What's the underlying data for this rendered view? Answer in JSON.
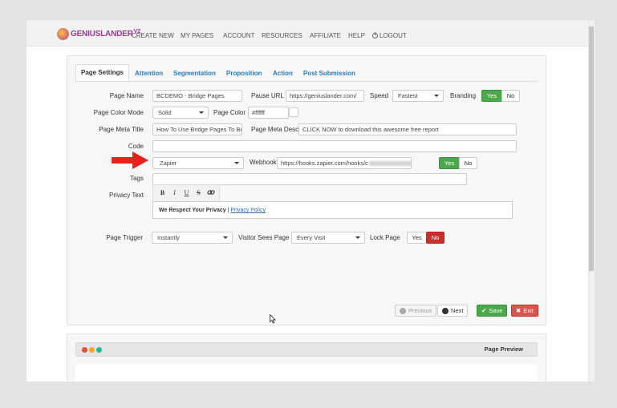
{
  "app": {
    "logo_text": "GENIUSLANDER",
    "logo_version": "V2"
  },
  "nav": {
    "items": [
      "CREATE NEW",
      "MY PAGES",
      "ACCOUNT",
      "RESOURCES",
      "AFFILIATE",
      "HELP"
    ],
    "logout_label": "LOGOUT"
  },
  "tabs": [
    "Page Settings",
    "Attention",
    "Segmentation",
    "Proposition",
    "Action",
    "Post Submission"
  ],
  "active_tab": "Page Settings",
  "form": {
    "page_name": {
      "label": "Page Name",
      "value": "BCDEMO - Bridge Pages"
    },
    "pause_url": {
      "label": "Pause URL",
      "value": "https://geniuslander.com/"
    },
    "speed": {
      "label": "Speed",
      "value": "Fastest"
    },
    "branding": {
      "label": "Branding",
      "yes": "Yes",
      "no": "No",
      "selected": "Yes"
    },
    "page_color_mode": {
      "label": "Page Color Mode",
      "value": "Solid"
    },
    "page_color": {
      "label": "Page Color",
      "value": "#ffffff"
    },
    "page_meta_title": {
      "label": "Page Meta Title",
      "value": "How To Use Bridge Pages To Bc"
    },
    "page_meta_desc": {
      "label": "Page Meta Desc",
      "value": "CLICK NOW to download this awesome free report"
    },
    "code": {
      "label": "Code",
      "value": ""
    },
    "integration": {
      "value": "Zapier"
    },
    "webhook": {
      "label": "Webhook",
      "value": "https://hooks.zapier.com/hooks/c",
      "yes": "Yes",
      "no": "No",
      "selected": "Yes"
    },
    "tags": {
      "label": "Tags",
      "value": ""
    },
    "privacy_text": {
      "label": "Privacy Text",
      "toolbar": [
        "B",
        "I",
        "U",
        "S",
        "link"
      ],
      "content_bold": "We Respect Your Privacy",
      "content_sep": " | ",
      "content_link": "Privacy Policy"
    },
    "page_trigger": {
      "label": "Page Trigger",
      "value": "Instantly"
    },
    "visitor_sees_page": {
      "label": "Visitor Sees Page",
      "value": "Every Visit"
    },
    "lock_page": {
      "label": "Lock Page",
      "yes": "Yes",
      "no": "No",
      "selected": "No"
    }
  },
  "actions": {
    "previous": "Previous",
    "next": "Next",
    "save": "Save",
    "exit": "Exit"
  },
  "preview": {
    "title": "Page Preview",
    "dot_colors": [
      "#e74c3c",
      "#f0a830",
      "#1abc9c"
    ]
  },
  "colors": {
    "accent_green": "#4ca84c",
    "accent_red": "#c9302c",
    "link_blue": "#2b7bb9",
    "arrow_red": "#e8221b"
  }
}
